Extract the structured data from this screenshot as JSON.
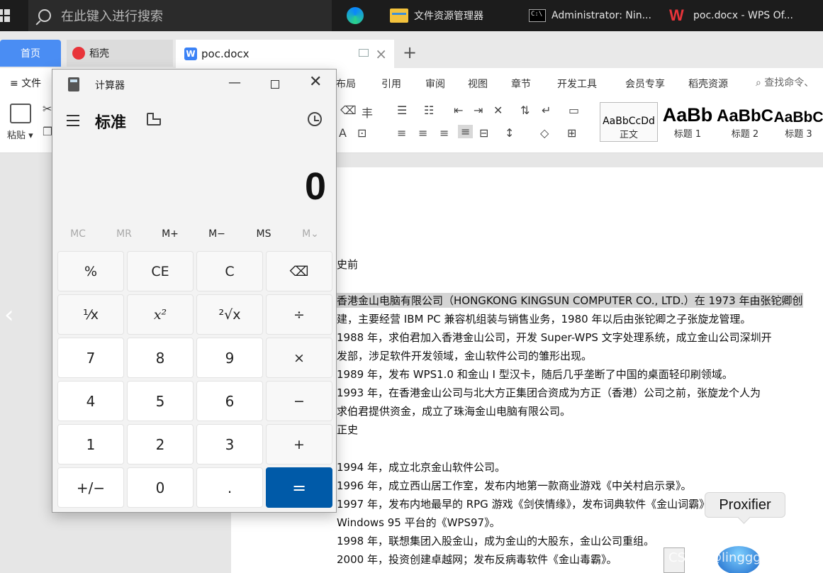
{
  "taskbar": {
    "search_placeholder": "在此键入进行搜索",
    "items": [
      "文件资源管理器",
      "Administrator: Nin...",
      "poc.docx - WPS Of..."
    ]
  },
  "wps": {
    "tabs": {
      "home": "首页",
      "daoke": "稻壳",
      "doc": "poc.docx"
    },
    "menu": {
      "file": "文件",
      "items": [
        "布局",
        "引用",
        "审阅",
        "视图",
        "章节",
        "开发工具",
        "会员专享",
        "稻壳资源"
      ],
      "search": "查找命令、"
    },
    "ribbon": {
      "paste": "粘贴",
      "styles": [
        {
          "preview": "AaBbCcDd",
          "label": "正文"
        },
        {
          "preview": "AaBb",
          "label": "标题 1"
        },
        {
          "preview": "AaBbC",
          "label": "标题 2"
        },
        {
          "preview": "AaBbC",
          "label": "标题 3"
        }
      ]
    },
    "document": {
      "lines": [
        "史前",
        "香港金山电脑有限公司（HONGKONG KINGSUN COMPUTER CO., LTD.）在 1973 年由张铊卿创",
        "建，主要经营 IBM PC 兼容机组装与销售业务，1980 年以后由张铊卿之子张旋龙管理。",
        "1988 年，求伯君加入香港金山公司，开发 Super-WPS 文字处理系统，成立金山公司深圳开",
        "发部，涉足软件开发领域，金山软件公司的雏形出现。",
        "1989 年，发布 WPS1.0 和金山 I 型汉卡，随后几乎垄断了中国的桌面轻印刷领域。",
        "1993 年，在香港金山公司与北大方正集团合资成为方正（香港）公司之前，张旋龙个人为",
        "求伯君提供资金，成立了珠海金山电脑有限公司。",
        "正史",
        "1994 年，成立北京金山软件公司。",
        "1996 年，成立西山居工作室，发布内地第一款商业游戏《中关村启示录》。",
        "1997 年，发布内地最早的 RPG 游戏《剑侠情缘》，发布词典软件《金山词霸》，后运行在",
        "Windows 95 平台的《WPS97》。",
        "1998 年，联想集团入股金山，成为金山的大股东，金山公司重组。",
        "2000 年，投资创建卓越网；发布反病毒软件《金山毒霸》。"
      ]
    }
  },
  "tooltip": {
    "proxifier": "Proxifier"
  },
  "watermark": "CSDN @linggggaaaa",
  "calculator": {
    "title": "计算器",
    "mode": "标准",
    "display": "0",
    "memory": [
      "MC",
      "MR",
      "M+",
      "M−",
      "MS",
      "M⌄"
    ],
    "keys": [
      [
        "%",
        "CE",
        "C",
        "⌫"
      ],
      [
        "¹⁄x",
        "x²",
        "²√x",
        "÷"
      ],
      [
        "7",
        "8",
        "9",
        "×"
      ],
      [
        "4",
        "5",
        "6",
        "−"
      ],
      [
        "1",
        "2",
        "3",
        "+"
      ],
      [
        "+/−",
        "0",
        ".",
        "="
      ]
    ]
  }
}
